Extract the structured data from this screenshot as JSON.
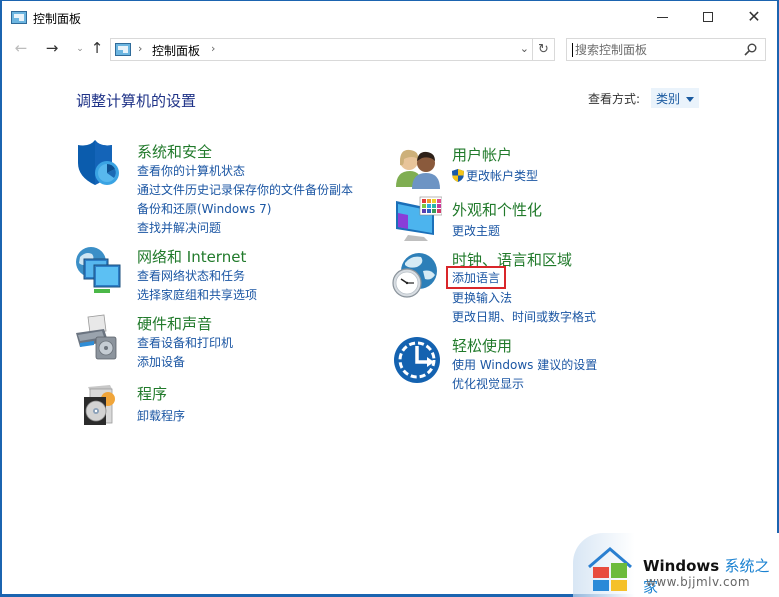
{
  "window": {
    "title": "控制面板",
    "controls": {
      "minimize": "minimize",
      "maximize": "maximize",
      "close": "✕"
    }
  },
  "nav": {
    "back": "←",
    "forward": "→",
    "recent": "⌄",
    "up": "↑",
    "address": {
      "separator": "›",
      "crumbs": [
        "控制面板"
      ],
      "dropdown": "⌄",
      "refresh": "↻"
    },
    "search": {
      "placeholder": "搜索控制面板",
      "value": ""
    }
  },
  "content": {
    "title": "调整计算机的设置",
    "view_by": {
      "label": "查看方式:",
      "selected": "类别"
    },
    "categories": [
      {
        "id": "system-security",
        "icon": "shield-icon",
        "title": "系统和安全",
        "links": [
          "查看你的计算机状态",
          "通过文件历史记录保存你的文件备份副本",
          "备份和还原(Windows 7)",
          "查找并解决问题"
        ]
      },
      {
        "id": "network-internet",
        "icon": "network-icon",
        "title": "网络和 Internet",
        "links": [
          "查看网络状态和任务",
          "选择家庭组和共享选项"
        ]
      },
      {
        "id": "hardware-sound",
        "icon": "printer-icon",
        "title": "硬件和声音",
        "links": [
          "查看设备和打印机",
          "添加设备"
        ]
      },
      {
        "id": "programs",
        "icon": "programs-icon",
        "title": "程序",
        "links": [
          "卸载程序"
        ]
      },
      {
        "id": "user-accounts",
        "icon": "users-icon",
        "title": "用户帐户",
        "links": [
          "更改帐户类型"
        ]
      },
      {
        "id": "appearance",
        "icon": "monitor-palette-icon",
        "title": "外观和个性化",
        "links": [
          "更改主题"
        ]
      },
      {
        "id": "clock-region",
        "icon": "globe-clock-icon",
        "title": "时钟、语言和区域",
        "links": [
          "添加语言",
          "更换输入法",
          "更改日期、时间或数字格式"
        ],
        "highlighted_link": "添加语言"
      },
      {
        "id": "ease-of-access",
        "icon": "ease-of-access-icon",
        "title": "轻松使用",
        "links": [
          "使用 Windows 建议的设置",
          "优化视觉显示"
        ]
      }
    ]
  },
  "watermark": {
    "brand": "Windows",
    "brand_cn": "系统之家",
    "url": "www.bjjmlv.com"
  },
  "colors": {
    "border": "#1b64b0",
    "category_title": "#217a2b",
    "link": "#1b56a3",
    "page_title": "#1e3287",
    "highlight": "#d9262a"
  }
}
